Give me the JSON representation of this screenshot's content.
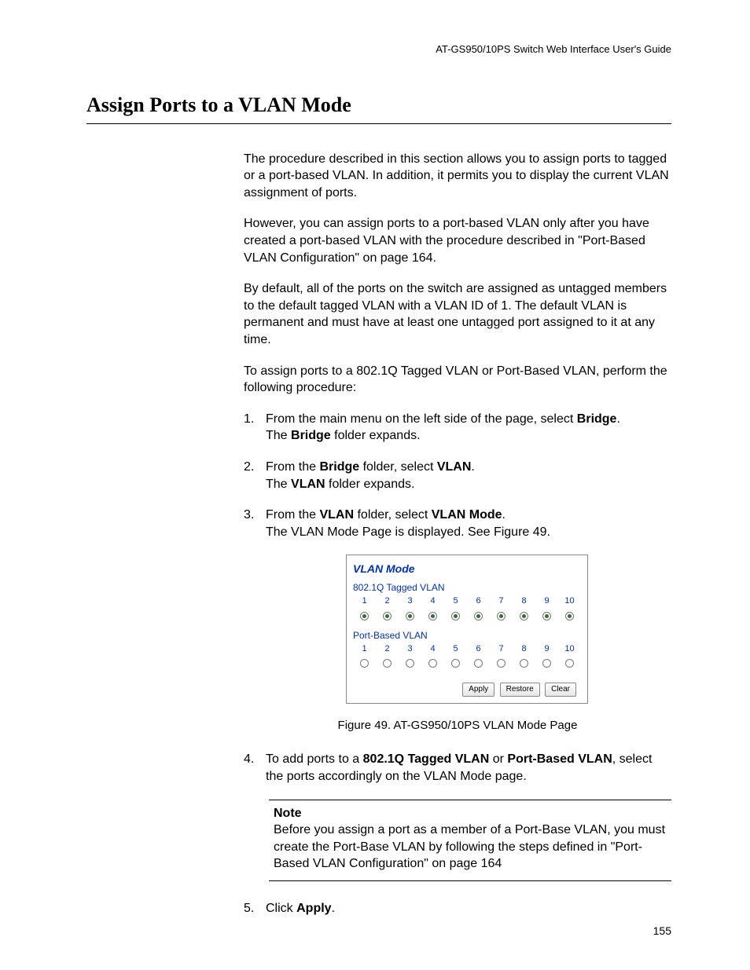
{
  "header": {
    "guide": "AT-GS950/10PS Switch Web Interface User's Guide"
  },
  "title": "Assign Ports to a VLAN Mode",
  "paras": {
    "p1": "The procedure described in this section allows you to assign ports to tagged or a port-based VLAN. In addition, it permits you to display the current VLAN assignment of ports.",
    "p2": "However, you can assign ports to a port-based VLAN only after you have created a port-based VLAN with the procedure described in \"Port-Based VLAN Configuration\" on page 164.",
    "p3": "By default, all of the ports on the switch are assigned as untagged members to the default tagged VLAN with a VLAN ID of 1. The default VLAN is permanent and must have at least one untagged port assigned to it at any time.",
    "p4": "To assign ports to a 802.1Q Tagged VLAN or Port-Based VLAN, perform the following procedure:"
  },
  "steps": {
    "s1": {
      "num": "1.",
      "a": "From the main menu on the left side of the page, select ",
      "b1": "Bridge",
      "c": ".",
      "line2a": "The ",
      "line2b": "Bridge",
      "line2c": " folder expands."
    },
    "s2": {
      "num": "2.",
      "a": "From the ",
      "b1": "Bridge",
      "c": " folder, select ",
      "b2": "VLAN",
      "d": ".",
      "line2a": "The ",
      "line2b": "VLAN",
      "line2c": " folder expands."
    },
    "s3": {
      "num": "3.",
      "a": "From the ",
      "b1": "VLAN",
      "c": " folder, select ",
      "b2": "VLAN Mode",
      "d": ".",
      "line2": "The VLAN Mode Page is displayed. See Figure 49."
    },
    "s4": {
      "num": "4.",
      "a": "To add ports to a ",
      "b1": "802.1Q Tagged VLAN",
      "c": " or ",
      "b2": "Port-Based VLAN",
      "d": ", select the ports accordingly on the VLAN Mode page."
    },
    "s5": {
      "num": "5.",
      "a": "Click ",
      "b1": "Apply",
      "c": "."
    }
  },
  "figure": {
    "title": "VLAN Mode",
    "tagged_label": "802.1Q Tagged VLAN",
    "portbased_label": "Port-Based VLAN",
    "ports": [
      "1",
      "2",
      "3",
      "4",
      "5",
      "6",
      "7",
      "8",
      "9",
      "10"
    ],
    "buttons": {
      "apply": "Apply",
      "restore": "Restore",
      "clear": "Clear"
    },
    "caption": "Figure 49. AT-GS950/10PS VLAN Mode Page"
  },
  "note": {
    "head": "Note",
    "body": "Before you assign a port as a member of a Port-Base VLAN, you must create the Port-Base VLAN by following the steps defined in \"Port-Based VLAN Configuration\" on page 164"
  },
  "page_number": "155"
}
